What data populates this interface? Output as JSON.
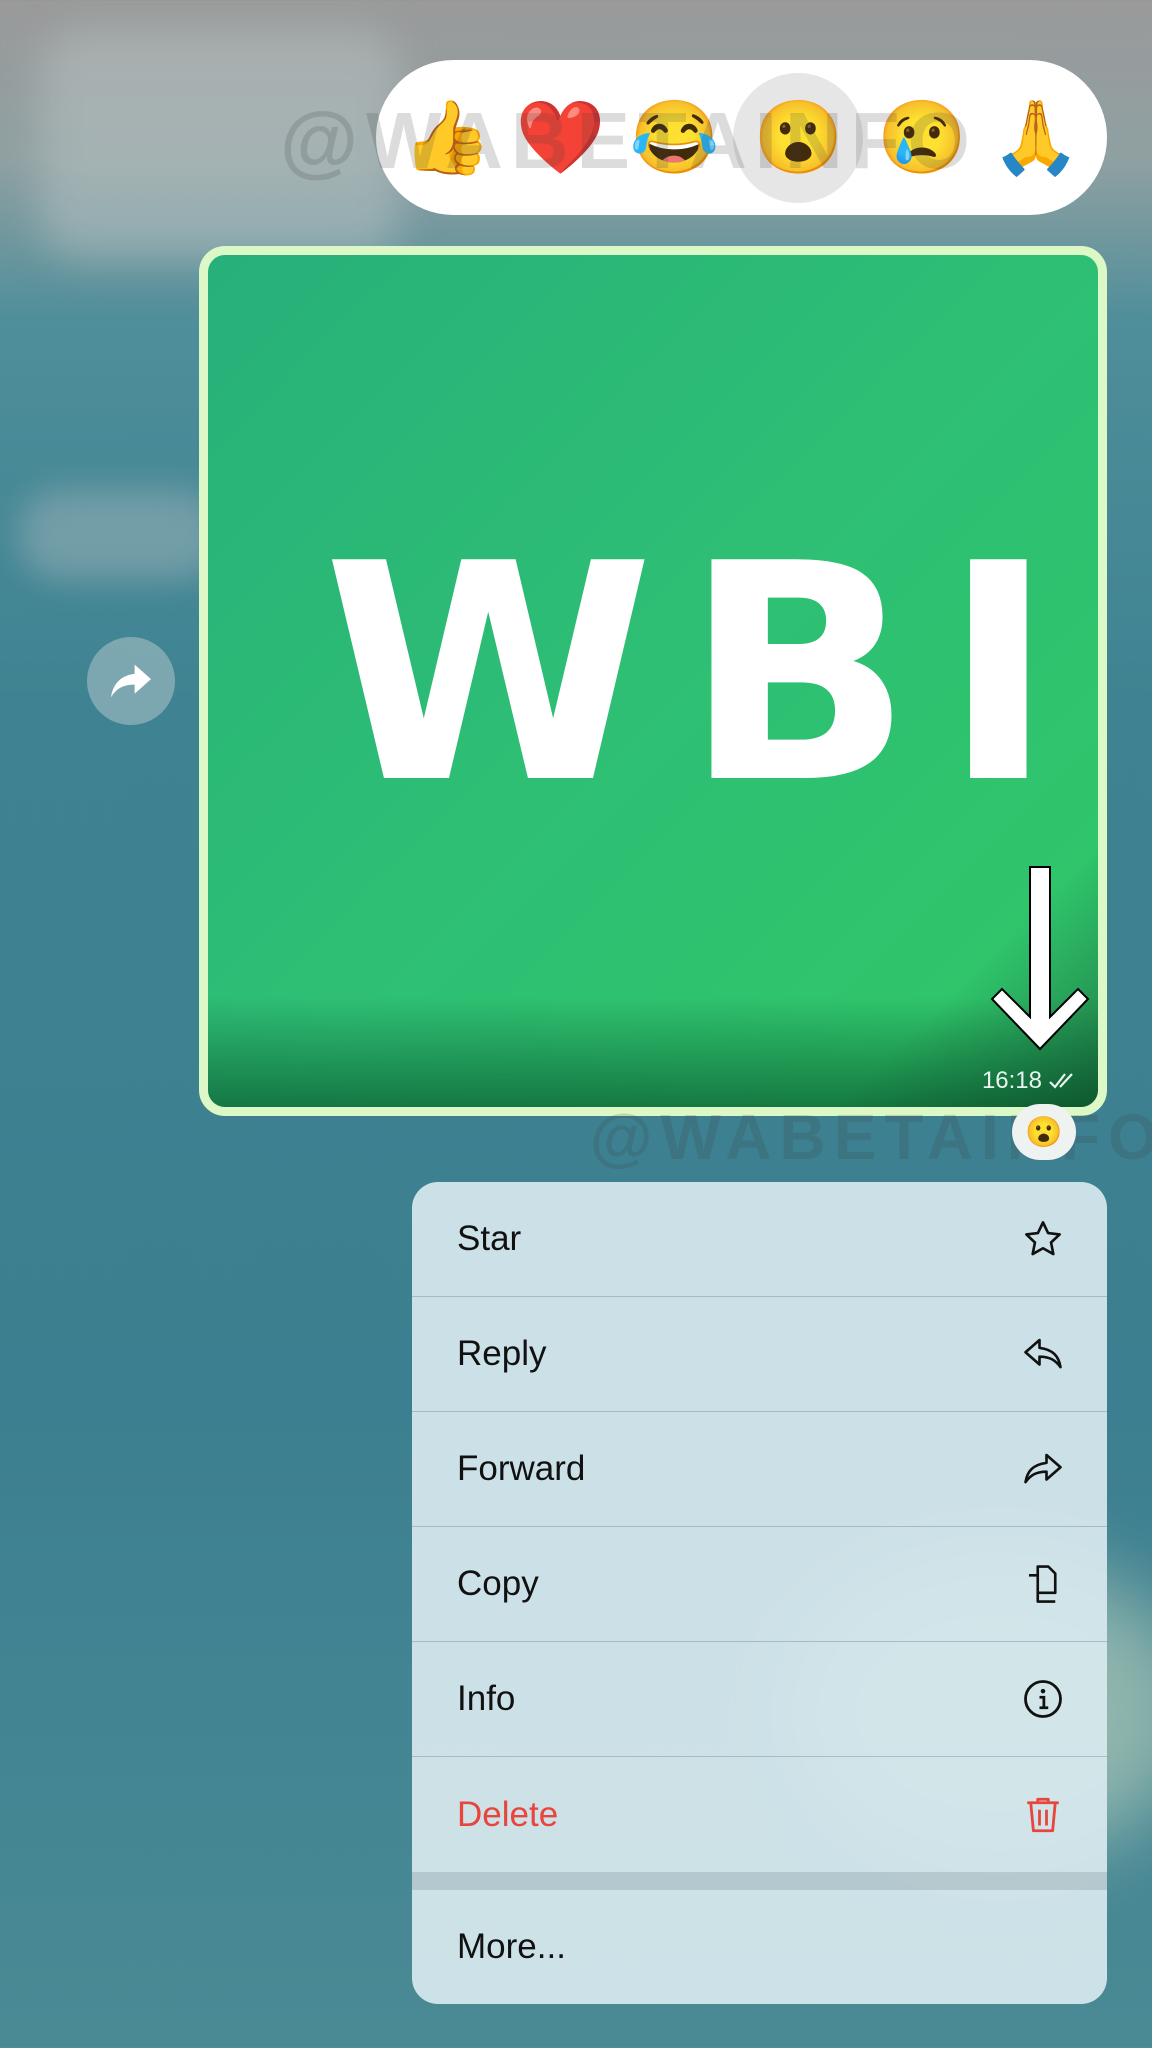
{
  "reactions": {
    "items": [
      {
        "emoji": "👍",
        "name": "thumbs-up"
      },
      {
        "emoji": "❤️",
        "name": "red-heart"
      },
      {
        "emoji": "😂",
        "name": "tears-of-joy"
      },
      {
        "emoji": "😮",
        "name": "open-mouth",
        "selected": true
      },
      {
        "emoji": "😢",
        "name": "crying"
      },
      {
        "emoji": "🙏",
        "name": "folded-hands"
      }
    ]
  },
  "message": {
    "image_text": "WBI",
    "time": "16:18",
    "status": "read",
    "reaction": "😮",
    "bubble_border": "#dcf8c6"
  },
  "watermark": "@WABETAINFO",
  "menu": {
    "star": "Star",
    "reply": "Reply",
    "forward": "Forward",
    "copy": "Copy",
    "info": "Info",
    "delete": "Delete",
    "more": "More...",
    "delete_color": "#e8453c"
  }
}
